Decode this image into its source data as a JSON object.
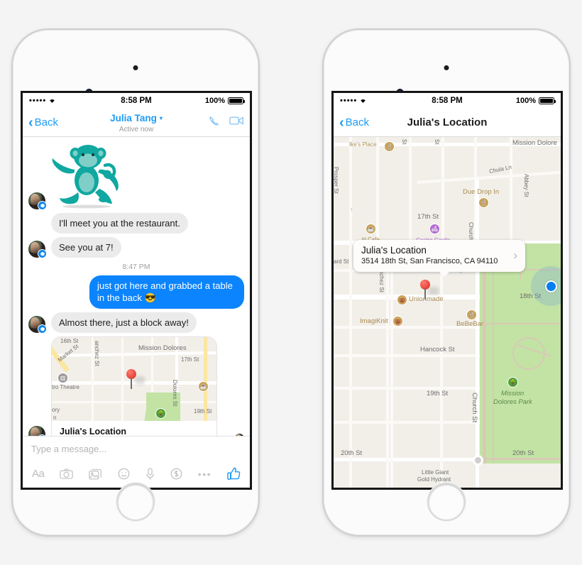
{
  "status_bar": {
    "signal_dots": "•••••",
    "wifi": "wifi-icon",
    "time": "8:58 PM",
    "battery_pct": "100%"
  },
  "left_phone": {
    "nav": {
      "back_label": "Back",
      "title": "Julia Tang",
      "caret": "▾",
      "subtitle": "Active now",
      "call_icon": "phone-icon",
      "video_icon": "video-camera-icon"
    },
    "messages": [
      {
        "type": "sticker",
        "from": "them",
        "alt": "monkey-sticker"
      },
      {
        "type": "text",
        "from": "them",
        "text": "I'll meet you at the restaurant."
      },
      {
        "type": "text",
        "from": "them",
        "text": "See you at 7!"
      },
      {
        "type": "timestamp",
        "text": "8:47 PM"
      },
      {
        "type": "text",
        "from": "me",
        "text": "just got here and grabbed a table in the back 😎"
      },
      {
        "type": "text",
        "from": "them",
        "text": "Almost there, just a block away!"
      },
      {
        "type": "map",
        "from": "them",
        "label": "Julia's Location"
      }
    ],
    "composer": {
      "placeholder": "Type a message...",
      "tools": [
        {
          "name": "text-format-button",
          "label": "Aa"
        },
        {
          "name": "camera-button",
          "label": "camera-icon"
        },
        {
          "name": "photo-gallery-button",
          "label": "photos-icon"
        },
        {
          "name": "sticker-button",
          "label": "smiley-icon"
        },
        {
          "name": "voice-recorder-button",
          "label": "microphone-icon"
        },
        {
          "name": "payment-button",
          "label": "dollar-icon"
        },
        {
          "name": "more-options-button",
          "label": "•••"
        },
        {
          "name": "like-button",
          "label": "thumbs-up-icon"
        }
      ]
    },
    "map_thumbnail_labels": [
      "16th St",
      "Market St",
      "Sanchez St",
      "Mission Dolores",
      "17th St",
      "Castro Theatre",
      "Dolores St",
      "19th St",
      "ory",
      "n"
    ]
  },
  "right_phone": {
    "nav": {
      "back_label": "Back",
      "title": "Julia's Location"
    },
    "callout": {
      "title": "Julia's Location",
      "address": "3514 18th St, San Francisco, CA 94110",
      "chevron": "›"
    },
    "map_labels": {
      "pois": [
        "Ike's Place",
        "Due Drop In",
        "H Cafe",
        "Castro Castle",
        "Unionmade",
        "ImagiKnit",
        "BeBeBar",
        "Little Giant Gold Hydrant"
      ],
      "streets": [
        "Prosper St",
        "Chula Ln",
        "Abbey St",
        "17th St",
        "Church St",
        "Sanchez St",
        "18th St",
        "Hancock St",
        "19th St",
        "20th St",
        "ard St",
        "St"
      ],
      "areas": [
        "Mission Dolores",
        "Mission Dolores Park"
      ]
    },
    "user_location_dot": "blue-location-dot"
  },
  "colors": {
    "messenger_blue": "#0b84fe",
    "link_blue": "#1d9bf6",
    "bubble_grey": "#ebebeb",
    "park_green": "#c2e3a4",
    "map_beige": "#f2efe9"
  }
}
